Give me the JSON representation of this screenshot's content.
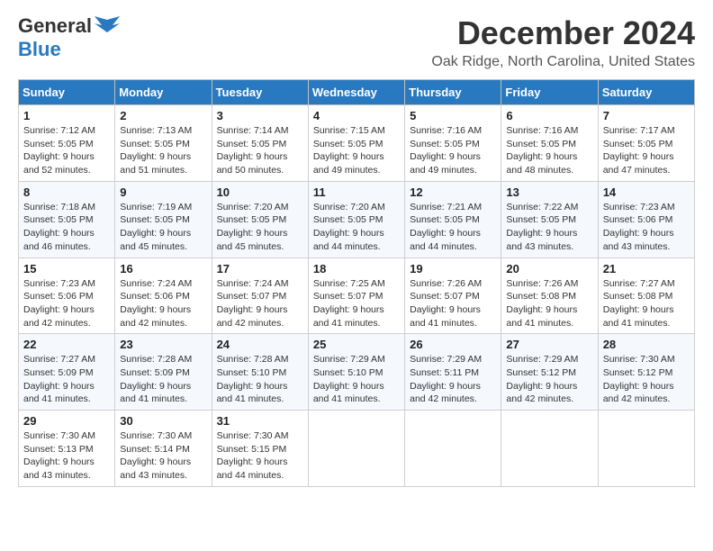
{
  "header": {
    "logo_general": "General",
    "logo_blue": "Blue",
    "month_year": "December 2024",
    "location": "Oak Ridge, North Carolina, United States"
  },
  "weekdays": [
    "Sunday",
    "Monday",
    "Tuesday",
    "Wednesday",
    "Thursday",
    "Friday",
    "Saturday"
  ],
  "weeks": [
    [
      {
        "day": "1",
        "sunrise": "Sunrise: 7:12 AM",
        "sunset": "Sunset: 5:05 PM",
        "daylight": "Daylight: 9 hours and 52 minutes."
      },
      {
        "day": "2",
        "sunrise": "Sunrise: 7:13 AM",
        "sunset": "Sunset: 5:05 PM",
        "daylight": "Daylight: 9 hours and 51 minutes."
      },
      {
        "day": "3",
        "sunrise": "Sunrise: 7:14 AM",
        "sunset": "Sunset: 5:05 PM",
        "daylight": "Daylight: 9 hours and 50 minutes."
      },
      {
        "day": "4",
        "sunrise": "Sunrise: 7:15 AM",
        "sunset": "Sunset: 5:05 PM",
        "daylight": "Daylight: 9 hours and 49 minutes."
      },
      {
        "day": "5",
        "sunrise": "Sunrise: 7:16 AM",
        "sunset": "Sunset: 5:05 PM",
        "daylight": "Daylight: 9 hours and 49 minutes."
      },
      {
        "day": "6",
        "sunrise": "Sunrise: 7:16 AM",
        "sunset": "Sunset: 5:05 PM",
        "daylight": "Daylight: 9 hours and 48 minutes."
      },
      {
        "day": "7",
        "sunrise": "Sunrise: 7:17 AM",
        "sunset": "Sunset: 5:05 PM",
        "daylight": "Daylight: 9 hours and 47 minutes."
      }
    ],
    [
      {
        "day": "8",
        "sunrise": "Sunrise: 7:18 AM",
        "sunset": "Sunset: 5:05 PM",
        "daylight": "Daylight: 9 hours and 46 minutes."
      },
      {
        "day": "9",
        "sunrise": "Sunrise: 7:19 AM",
        "sunset": "Sunset: 5:05 PM",
        "daylight": "Daylight: 9 hours and 45 minutes."
      },
      {
        "day": "10",
        "sunrise": "Sunrise: 7:20 AM",
        "sunset": "Sunset: 5:05 PM",
        "daylight": "Daylight: 9 hours and 45 minutes."
      },
      {
        "day": "11",
        "sunrise": "Sunrise: 7:20 AM",
        "sunset": "Sunset: 5:05 PM",
        "daylight": "Daylight: 9 hours and 44 minutes."
      },
      {
        "day": "12",
        "sunrise": "Sunrise: 7:21 AM",
        "sunset": "Sunset: 5:05 PM",
        "daylight": "Daylight: 9 hours and 44 minutes."
      },
      {
        "day": "13",
        "sunrise": "Sunrise: 7:22 AM",
        "sunset": "Sunset: 5:05 PM",
        "daylight": "Daylight: 9 hours and 43 minutes."
      },
      {
        "day": "14",
        "sunrise": "Sunrise: 7:23 AM",
        "sunset": "Sunset: 5:06 PM",
        "daylight": "Daylight: 9 hours and 43 minutes."
      }
    ],
    [
      {
        "day": "15",
        "sunrise": "Sunrise: 7:23 AM",
        "sunset": "Sunset: 5:06 PM",
        "daylight": "Daylight: 9 hours and 42 minutes."
      },
      {
        "day": "16",
        "sunrise": "Sunrise: 7:24 AM",
        "sunset": "Sunset: 5:06 PM",
        "daylight": "Daylight: 9 hours and 42 minutes."
      },
      {
        "day": "17",
        "sunrise": "Sunrise: 7:24 AM",
        "sunset": "Sunset: 5:07 PM",
        "daylight": "Daylight: 9 hours and 42 minutes."
      },
      {
        "day": "18",
        "sunrise": "Sunrise: 7:25 AM",
        "sunset": "Sunset: 5:07 PM",
        "daylight": "Daylight: 9 hours and 41 minutes."
      },
      {
        "day": "19",
        "sunrise": "Sunrise: 7:26 AM",
        "sunset": "Sunset: 5:07 PM",
        "daylight": "Daylight: 9 hours and 41 minutes."
      },
      {
        "day": "20",
        "sunrise": "Sunrise: 7:26 AM",
        "sunset": "Sunset: 5:08 PM",
        "daylight": "Daylight: 9 hours and 41 minutes."
      },
      {
        "day": "21",
        "sunrise": "Sunrise: 7:27 AM",
        "sunset": "Sunset: 5:08 PM",
        "daylight": "Daylight: 9 hours and 41 minutes."
      }
    ],
    [
      {
        "day": "22",
        "sunrise": "Sunrise: 7:27 AM",
        "sunset": "Sunset: 5:09 PM",
        "daylight": "Daylight: 9 hours and 41 minutes."
      },
      {
        "day": "23",
        "sunrise": "Sunrise: 7:28 AM",
        "sunset": "Sunset: 5:09 PM",
        "daylight": "Daylight: 9 hours and 41 minutes."
      },
      {
        "day": "24",
        "sunrise": "Sunrise: 7:28 AM",
        "sunset": "Sunset: 5:10 PM",
        "daylight": "Daylight: 9 hours and 41 minutes."
      },
      {
        "day": "25",
        "sunrise": "Sunrise: 7:29 AM",
        "sunset": "Sunset: 5:10 PM",
        "daylight": "Daylight: 9 hours and 41 minutes."
      },
      {
        "day": "26",
        "sunrise": "Sunrise: 7:29 AM",
        "sunset": "Sunset: 5:11 PM",
        "daylight": "Daylight: 9 hours and 42 minutes."
      },
      {
        "day": "27",
        "sunrise": "Sunrise: 7:29 AM",
        "sunset": "Sunset: 5:12 PM",
        "daylight": "Daylight: 9 hours and 42 minutes."
      },
      {
        "day": "28",
        "sunrise": "Sunrise: 7:30 AM",
        "sunset": "Sunset: 5:12 PM",
        "daylight": "Daylight: 9 hours and 42 minutes."
      }
    ],
    [
      {
        "day": "29",
        "sunrise": "Sunrise: 7:30 AM",
        "sunset": "Sunset: 5:13 PM",
        "daylight": "Daylight: 9 hours and 43 minutes."
      },
      {
        "day": "30",
        "sunrise": "Sunrise: 7:30 AM",
        "sunset": "Sunset: 5:14 PM",
        "daylight": "Daylight: 9 hours and 43 minutes."
      },
      {
        "day": "31",
        "sunrise": "Sunrise: 7:30 AM",
        "sunset": "Sunset: 5:15 PM",
        "daylight": "Daylight: 9 hours and 44 minutes."
      },
      null,
      null,
      null,
      null
    ]
  ]
}
